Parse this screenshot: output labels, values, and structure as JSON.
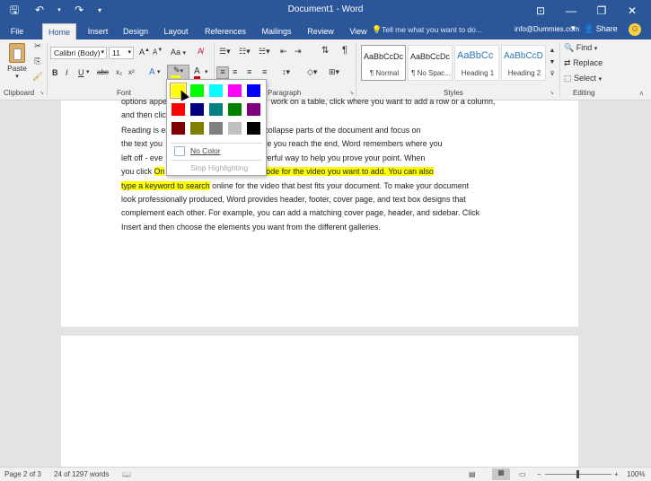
{
  "title_bar": {
    "title": "Document1 - Word",
    "save_icon": "save-icon",
    "undo_icon": "undo-icon",
    "redo_icon": "redo-icon",
    "customize_icon": "customize-qat-icon",
    "ribbon_display_icon": "ribbon-display-icon",
    "minimize_icon": "minimize-icon",
    "maximize_icon": "maximize-icon",
    "close_icon": "close-icon",
    "bg_color": "#2b579a"
  },
  "tabs": [
    {
      "label": "File"
    },
    {
      "label": "Home"
    },
    {
      "label": "Insert"
    },
    {
      "label": "Design"
    },
    {
      "label": "Layout"
    },
    {
      "label": "References"
    },
    {
      "label": "Mailings"
    },
    {
      "label": "Review"
    },
    {
      "label": "View"
    }
  ],
  "active_tab": "Home",
  "tell_me": "Tell me what you want to do...",
  "account": "info@Dummies.com",
  "share": "Share",
  "ribbon": {
    "clipboard": {
      "paste": "Paste",
      "group": "Clipboard"
    },
    "font": {
      "name": "Calibri (Body)",
      "size": "11",
      "group": "Font",
      "grow_shrink": "Aa"
    },
    "paragraph": {
      "group": "Paragraph"
    },
    "styles": {
      "group": "Styles",
      "items": [
        {
          "sample": "AaBbCcDc",
          "name": "¶ Normal"
        },
        {
          "sample": "AaBbCcDc",
          "name": "¶ No Spac..."
        },
        {
          "sample": "AaBbCc",
          "name": "Heading 1"
        },
        {
          "sample": "AaBbCcD",
          "name": "Heading 2"
        }
      ]
    },
    "editing": {
      "find": "Find",
      "replace": "Replace",
      "select": "Select",
      "group": "Editing"
    }
  },
  "highlight_menu": {
    "colors": [
      "#ffff00",
      "#00ff00",
      "#00ffff",
      "#ff00ff",
      "#0000ff",
      "#ff0000",
      "#000080",
      "#008080",
      "#008000",
      "#800080",
      "#800000",
      "#808000",
      "#808080",
      "#c0c0c0",
      "#000000"
    ],
    "selected_index": 0,
    "no_color": "No Color",
    "stop_highlighting": "Stop Highlighting"
  },
  "document": {
    "para1": [
      {
        "text": "options appear"
      },
      {
        "text": "and then clic"
      }
    ],
    "para1_tails": [
      {
        "text": "work on a table, click where you want to add a row or a column,"
      }
    ],
    "para2_lines": [
      [
        {
          "t": "Reading is ea",
          "h": false
        },
        {
          "t": "            ",
          "h": false
        },
        {
          "t": "ding view. You can collapse parts of the document and focus on",
          "h": false
        }
      ],
      [
        {
          "t": "the text you",
          "h": false
        },
        {
          "t": "                          ",
          "h": false
        },
        {
          "t": "reading before you reach the end, Word remembers where you",
          "h": false
        }
      ],
      [
        {
          "t": "left off - eve",
          "h": false
        },
        {
          "t": "                    ",
          "h": false
        },
        {
          "t": "o provides a powerful way to help you prove your point. When",
          "h": false
        }
      ],
      [
        {
          "t": "you click ",
          "h": false
        },
        {
          "t": "On",
          "h": true
        },
        {
          "t": "                       ",
          "h": false
        },
        {
          "t": "n the embed code for the video you want to add. You can also",
          "h": true
        }
      ],
      [
        {
          "t": "type a keyword to search",
          "h": true
        },
        {
          "t": " online for the video that best fits your document. To make your document",
          "h": false
        }
      ],
      [
        {
          "t": "look professionally produced, Word provides header, footer, cover page, and text box designs that",
          "h": false
        }
      ],
      [
        {
          "t": "complement each other. For example, you can add a matching cover page, header, and sidebar. Click",
          "h": false
        }
      ],
      [
        {
          "t": "Insert and then choose the elements you want from the different galleries.",
          "h": false
        }
      ]
    ]
  },
  "status": {
    "page": "Page 2 of 3",
    "words": "24 of 1297 words",
    "zoom": "100%",
    "zoom_minus": "−",
    "zoom_plus": "+"
  },
  "highlight_color": "#ffff00"
}
